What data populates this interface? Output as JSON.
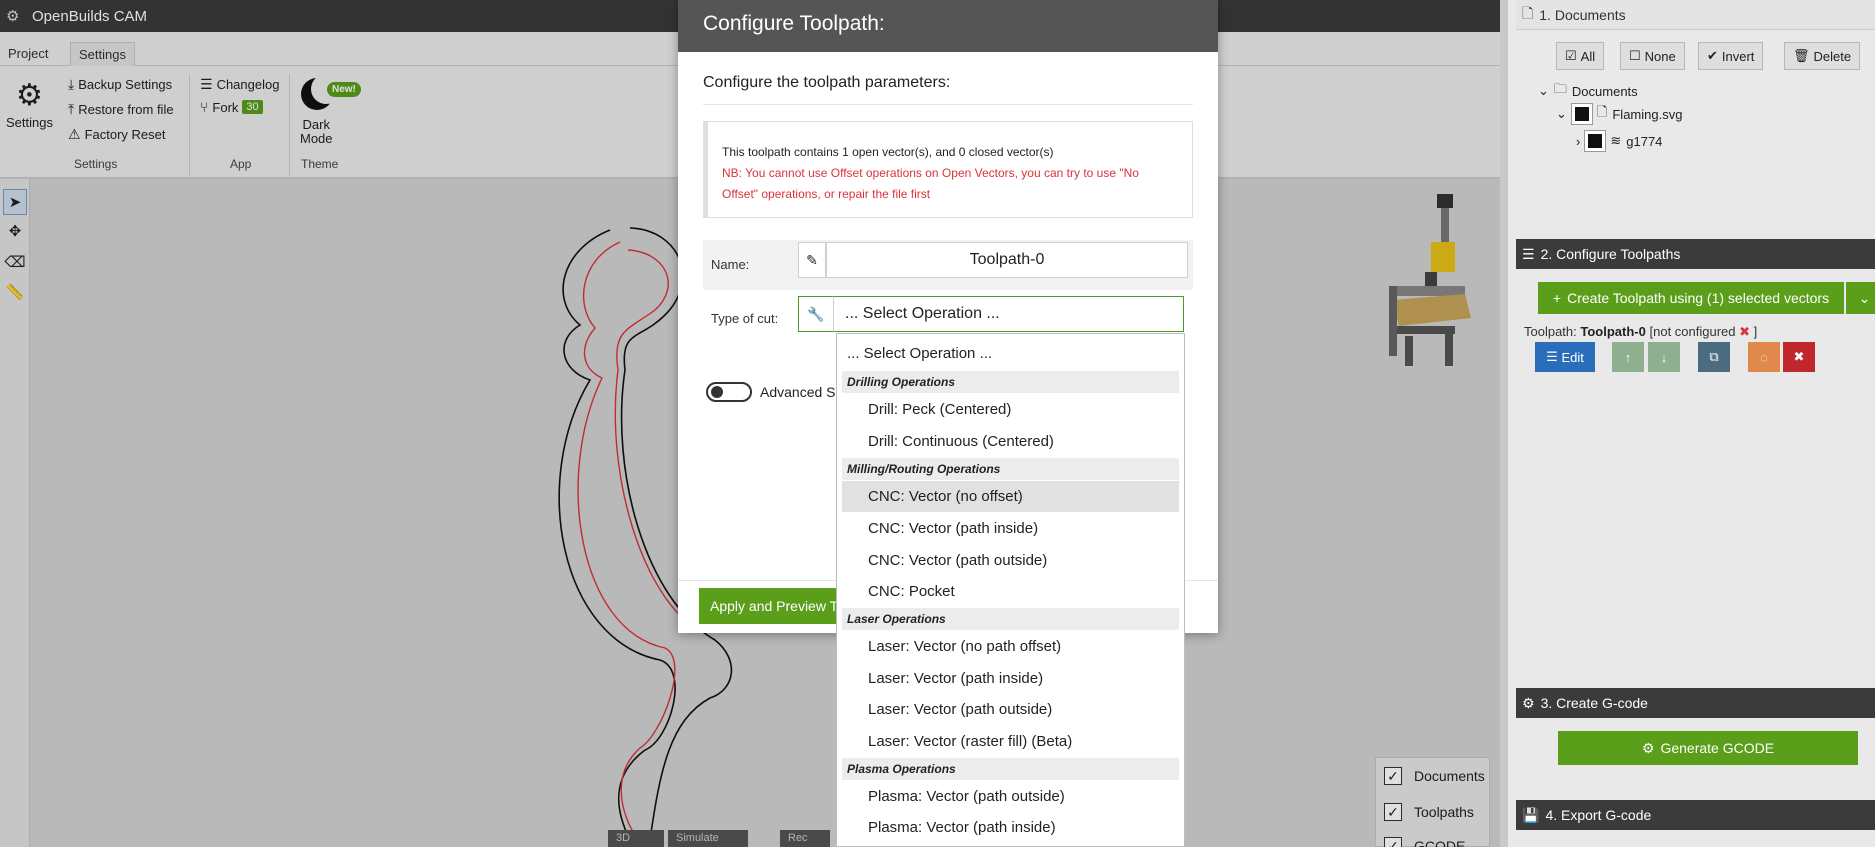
{
  "app": {
    "title": "OpenBuilds CAM"
  },
  "ribbon": {
    "tabs": [
      "Project",
      "Settings"
    ],
    "settings_label": "Settings",
    "backup": "Backup Settings",
    "restore": "Restore from file",
    "factory_reset": "Factory Reset",
    "changelog": "Changelog",
    "fork": "Fork",
    "fork_count": "30",
    "dark_mode_1": "Dark",
    "dark_mode_2": "Mode",
    "new_badge": "New!",
    "groups": [
      "Settings",
      "App",
      "Theme"
    ]
  },
  "layers": {
    "documents": "Documents",
    "toolpaths": "Toolpaths",
    "gcode": "GCODE"
  },
  "bottom_buttons": [
    "3D",
    "Simulate",
    "Rec"
  ],
  "right_panel": {
    "section1": "1. Documents",
    "btn_all": "All",
    "btn_none": "None",
    "btn_invert": "Invert",
    "btn_delete": "Delete",
    "tree_root": "Documents",
    "tree_file": "Flaming.svg",
    "tree_layer": "g1774",
    "section2": "2. Configure Toolpaths",
    "create_btn": "Create Toolpath using (1) selected vectors",
    "toolpath_prefix": "Toolpath:",
    "toolpath_name": "Toolpath-0",
    "toolpath_status": "[not configured",
    "toolpath_status_end": "]",
    "edit_btn": "Edit",
    "section3": "3. Create G-code",
    "generate_btn": "Generate GCODE",
    "section4": "4. Export G-code"
  },
  "modal": {
    "title": "Configure Toolpath:",
    "subtitle": "Configure the toolpath parameters:",
    "info_line": "This toolpath contains 1 open vector(s), and 0 closed vector(s)",
    "warning": "NB: You cannot use Offset operations on Open Vectors, you can try to use \"No Offset\" operations, or repair the file first",
    "name_label": "Name:",
    "name_value": "Toolpath-0",
    "cut_label": "Type of cut:",
    "cut_value": "... Select Operation ...",
    "advanced_label": "Advanced Se",
    "apply_btn": "Apply and Preview T"
  },
  "dropdown": {
    "placeholder": "... Select Operation ...",
    "drilling": "Drilling Operations",
    "drill_peck": "Drill: Peck (Centered)",
    "drill_continuous": "Drill: Continuous (Centered)",
    "milling": "Milling/Routing Operations",
    "cnc_no_offset": "CNC: Vector (no offset)",
    "cnc_inside": "CNC: Vector (path inside)",
    "cnc_outside": "CNC: Vector (path outside)",
    "cnc_pocket": "CNC: Pocket",
    "laser": "Laser Operations",
    "laser_no_offset": "Laser: Vector (no path offset)",
    "laser_inside": "Laser: Vector (path inside)",
    "laser_outside": "Laser: Vector (path outside)",
    "laser_raster": "Laser: Vector (raster fill) (Beta)",
    "plasma": "Plasma Operations",
    "plasma_outside": "Plasma: Vector (path outside)",
    "plasma_inside": "Plasma: Vector (path inside)"
  },
  "colors": {
    "accent_green": "#5a9e1a",
    "header_dark": "#3b3b3b",
    "warning_red": "#d9343b"
  }
}
